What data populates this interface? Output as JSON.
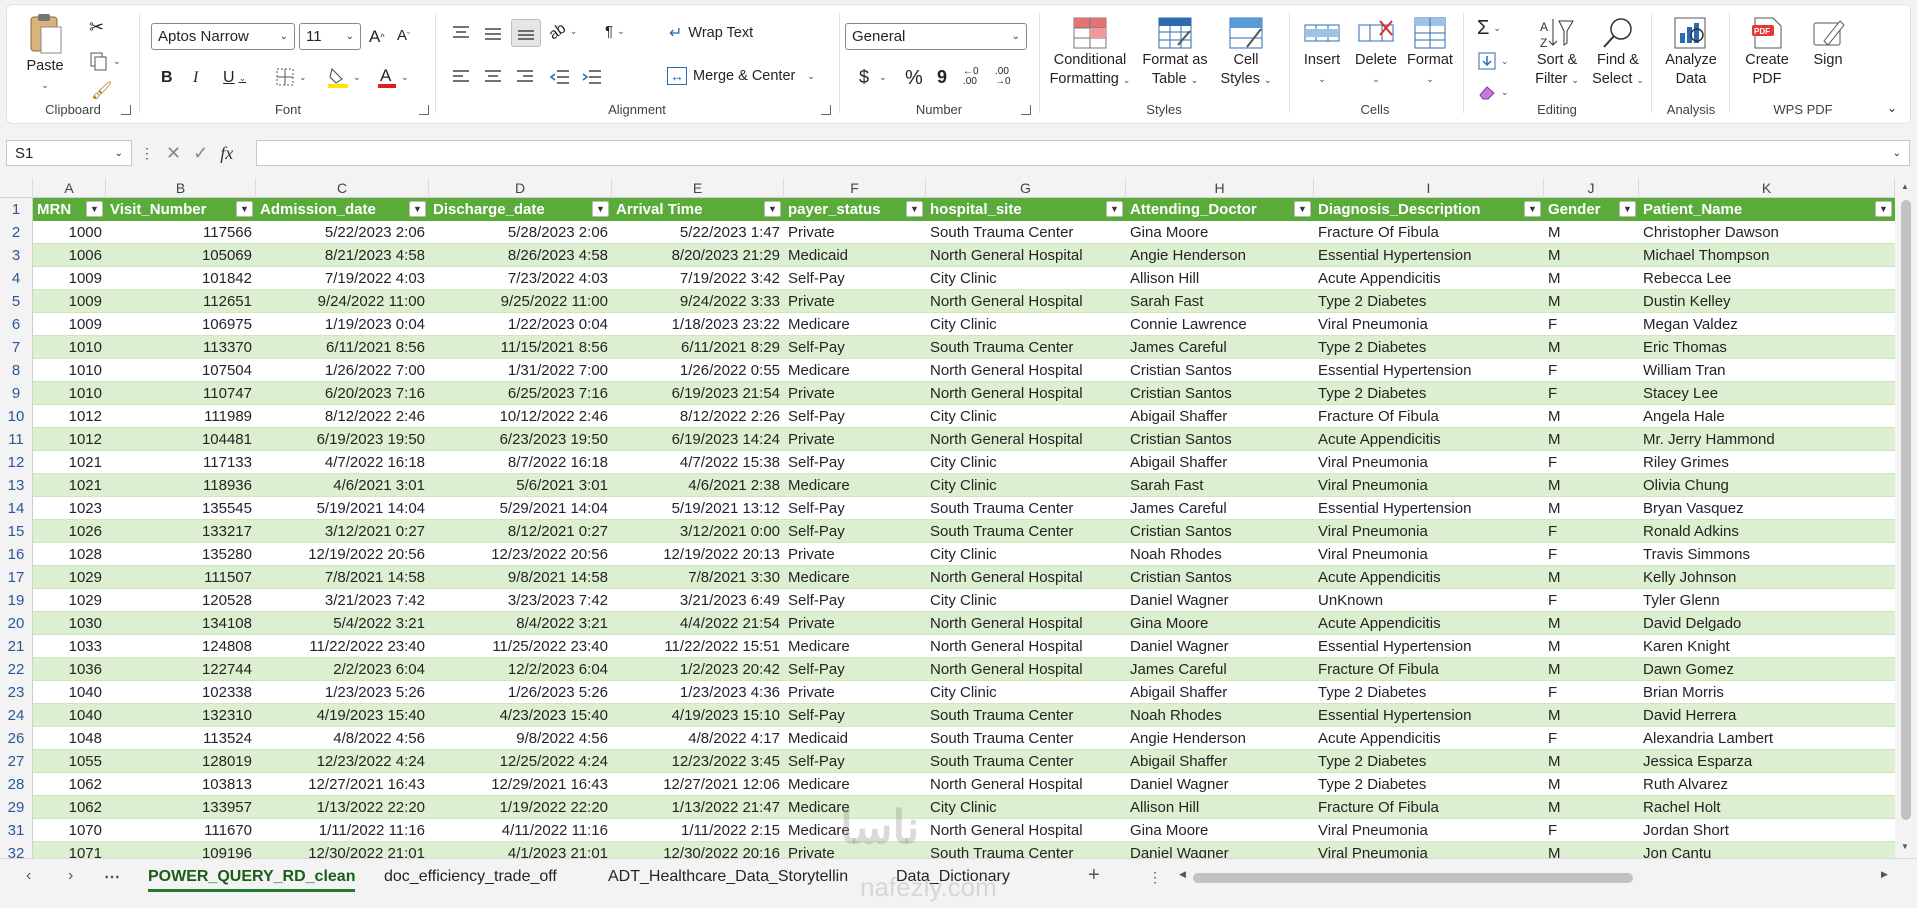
{
  "ribbon": {
    "clipboard": {
      "paste": "Paste",
      "label": "Clipboard"
    },
    "font": {
      "name": "Aptos Narrow",
      "size": "11",
      "label": "Font",
      "bold": "B",
      "italic": "I",
      "underline": "U",
      "font_color": "A"
    },
    "alignment": {
      "wrap": "Wrap Text",
      "merge": "Merge & Center",
      "label": "Alignment"
    },
    "number": {
      "format": "General",
      "currency": "$",
      "percent": "%",
      "comma": "9",
      "label": "Number"
    },
    "styles": {
      "conditional_1": "Conditional",
      "conditional_2": "Formatting",
      "format_table_1": "Format as",
      "format_table_2": "Table",
      "cell_styles_1": "Cell",
      "cell_styles_2": "Styles",
      "label": "Styles"
    },
    "cells": {
      "insert": "Insert",
      "delete": "Delete",
      "format": "Format",
      "label": "Cells"
    },
    "editing": {
      "sort_1": "Sort &",
      "sort_2": "Filter",
      "find_1": "Find &",
      "find_2": "Select",
      "label": "Editing"
    },
    "analysis": {
      "analyze_1": "Analyze",
      "analyze_2": "Data",
      "label": "Analysis"
    },
    "wps": {
      "create_1": "Create",
      "create_2": "PDF",
      "sign": "Sign",
      "label": "WPS PDF"
    }
  },
  "formula_bar": {
    "name_box": "S1",
    "fx": "fx",
    "formula": ""
  },
  "columns": [
    "A",
    "B",
    "C",
    "D",
    "E",
    "F",
    "G",
    "H",
    "I",
    "J",
    "K"
  ],
  "header": [
    "MRN",
    "Visit_Number",
    "Admission_date",
    "Discharge_date",
    "Arrival Time",
    "payer_status",
    "hospital_site",
    "Attending_Doctor",
    "Diagnosis_Description",
    "Gender",
    "Patient_Name"
  ],
  "rows": [
    {
      "n": "2",
      "cells": [
        "1000",
        "117566",
        "5/22/2023 2:06",
        "5/28/2023 2:06",
        "5/22/2023 1:47",
        "Private",
        "South Trauma Center",
        "Gina Moore",
        "Fracture Of Fibula",
        "M",
        "Christopher Dawson"
      ]
    },
    {
      "n": "3",
      "cells": [
        "1006",
        "105069",
        "8/21/2023 4:58",
        "8/26/2023 4:58",
        "8/20/2023 21:29",
        "Medicaid",
        "North General Hospital",
        "Angie Henderson",
        "Essential Hypertension",
        "M",
        "Michael Thompson"
      ]
    },
    {
      "n": "4",
      "cells": [
        "1009",
        "101842",
        "7/19/2022 4:03",
        "7/23/2022 4:03",
        "7/19/2022 3:42",
        "Self-Pay",
        "City Clinic",
        "Allison Hill",
        "Acute Appendicitis",
        "M",
        "Rebecca Lee"
      ]
    },
    {
      "n": "5",
      "cells": [
        "1009",
        "112651",
        "9/24/2022 11:00",
        "9/25/2022 11:00",
        "9/24/2022 3:33",
        "Private",
        "North General Hospital",
        "Sarah Fast",
        "Type 2 Diabetes",
        "M",
        "Dustin Kelley"
      ]
    },
    {
      "n": "6",
      "cells": [
        "1009",
        "106975",
        "1/19/2023 0:04",
        "1/22/2023 0:04",
        "1/18/2023 23:22",
        "Medicare",
        "City Clinic",
        "Connie Lawrence",
        "Viral Pneumonia",
        "F",
        "Megan Valdez"
      ]
    },
    {
      "n": "7",
      "cells": [
        "1010",
        "113370",
        "6/11/2021 8:56",
        "11/15/2021 8:56",
        "6/11/2021 8:29",
        "Self-Pay",
        "South Trauma Center",
        "James Careful",
        "Type 2 Diabetes",
        "M",
        "Eric Thomas"
      ]
    },
    {
      "n": "8",
      "cells": [
        "1010",
        "107504",
        "1/26/2022 7:00",
        "1/31/2022 7:00",
        "1/26/2022 0:55",
        "Medicare",
        "North General Hospital",
        "Cristian Santos",
        "Essential Hypertension",
        "F",
        "William Tran"
      ]
    },
    {
      "n": "9",
      "cells": [
        "1010",
        "110747",
        "6/20/2023 7:16",
        "6/25/2023 7:16",
        "6/19/2023 21:54",
        "Private",
        "North General Hospital",
        "Cristian Santos",
        "Type 2 Diabetes",
        "F",
        "Stacey Lee"
      ]
    },
    {
      "n": "10",
      "cells": [
        "1012",
        "111989",
        "8/12/2022 2:46",
        "10/12/2022 2:46",
        "8/12/2022 2:26",
        "Self-Pay",
        "City Clinic",
        "Abigail Shaffer",
        "Fracture Of Fibula",
        "M",
        "Angela Hale"
      ]
    },
    {
      "n": "11",
      "cells": [
        "1012",
        "104481",
        "6/19/2023 19:50",
        "6/23/2023 19:50",
        "6/19/2023 14:24",
        "Private",
        "North General Hospital",
        "Cristian Santos",
        "Acute Appendicitis",
        "M",
        "Mr. Jerry Hammond"
      ]
    },
    {
      "n": "12",
      "cells": [
        "1021",
        "117133",
        "4/7/2022 16:18",
        "8/7/2022 16:18",
        "4/7/2022 15:38",
        "Self-Pay",
        "City Clinic",
        "Abigail Shaffer",
        "Viral Pneumonia",
        "F",
        "Riley Grimes"
      ]
    },
    {
      "n": "13",
      "cells": [
        "1021",
        "118936",
        "4/6/2021 3:01",
        "5/6/2021 3:01",
        "4/6/2021 2:38",
        "Medicare",
        "City Clinic",
        "Sarah Fast",
        "Viral Pneumonia",
        "M",
        "Olivia Chung"
      ]
    },
    {
      "n": "14",
      "cells": [
        "1023",
        "135545",
        "5/19/2021 14:04",
        "5/29/2021 14:04",
        "5/19/2021 13:12",
        "Self-Pay",
        "South Trauma Center",
        "James Careful",
        "Essential Hypertension",
        "M",
        "Bryan Vasquez"
      ]
    },
    {
      "n": "15",
      "cells": [
        "1026",
        "133217",
        "3/12/2021 0:27",
        "8/12/2021 0:27",
        "3/12/2021 0:00",
        "Self-Pay",
        "South Trauma Center",
        "Cristian Santos",
        "Viral Pneumonia",
        "F",
        "Ronald Adkins"
      ]
    },
    {
      "n": "16",
      "cells": [
        "1028",
        "135280",
        "12/19/2022 20:56",
        "12/23/2022 20:56",
        "12/19/2022 20:13",
        "Private",
        "City Clinic",
        "Noah Rhodes",
        "Viral Pneumonia",
        "F",
        "Travis Simmons"
      ]
    },
    {
      "n": "17",
      "cells": [
        "1029",
        "111507",
        "7/8/2021 14:58",
        "9/8/2021 14:58",
        "7/8/2021 3:30",
        "Medicare",
        "North General Hospital",
        "Cristian Santos",
        "Acute Appendicitis",
        "M",
        "Kelly Johnson"
      ]
    },
    {
      "n": "19",
      "cells": [
        "1029",
        "120528",
        "3/21/2023 7:42",
        "3/23/2023 7:42",
        "3/21/2023 6:49",
        "Self-Pay",
        "City Clinic",
        "Daniel Wagner",
        "UnKnown",
        "F",
        "Tyler Glenn"
      ]
    },
    {
      "n": "20",
      "cells": [
        "1030",
        "134108",
        "5/4/2022 3:21",
        "8/4/2022 3:21",
        "4/4/2022 21:54",
        "Private",
        "North General Hospital",
        "Gina Moore",
        "Acute Appendicitis",
        "M",
        "David Delgado"
      ]
    },
    {
      "n": "21",
      "cells": [
        "1033",
        "124808",
        "11/22/2022 23:40",
        "11/25/2022 23:40",
        "11/22/2022 15:51",
        "Medicare",
        "North General Hospital",
        "Daniel Wagner",
        "Essential Hypertension",
        "M",
        "Karen Knight"
      ]
    },
    {
      "n": "22",
      "cells": [
        "1036",
        "122744",
        "2/2/2023 6:04",
        "12/2/2023 6:04",
        "1/2/2023 20:42",
        "Self-Pay",
        "North General Hospital",
        "James Careful",
        "Fracture Of Fibula",
        "M",
        "Dawn Gomez"
      ]
    },
    {
      "n": "23",
      "cells": [
        "1040",
        "102338",
        "1/23/2023 5:26",
        "1/26/2023 5:26",
        "1/23/2023 4:36",
        "Private",
        "City Clinic",
        "Abigail Shaffer",
        "Type 2 Diabetes",
        "F",
        "Brian Morris"
      ]
    },
    {
      "n": "24",
      "cells": [
        "1040",
        "132310",
        "4/19/2023 15:40",
        "4/23/2023 15:40",
        "4/19/2023 15:10",
        "Self-Pay",
        "South Trauma Center",
        "Noah Rhodes",
        "Essential Hypertension",
        "M",
        "David Herrera"
      ]
    },
    {
      "n": "26",
      "cells": [
        "1048",
        "113524",
        "4/8/2022 4:56",
        "9/8/2022 4:56",
        "4/8/2022 4:17",
        "Medicaid",
        "South Trauma Center",
        "Angie Henderson",
        "Acute Appendicitis",
        "F",
        "Alexandria Lambert"
      ]
    },
    {
      "n": "27",
      "cells": [
        "1055",
        "128019",
        "12/23/2022 4:24",
        "12/25/2022 4:24",
        "12/23/2022 3:45",
        "Self-Pay",
        "South Trauma Center",
        "Abigail Shaffer",
        "Type 2 Diabetes",
        "M",
        "Jessica Esparza"
      ]
    },
    {
      "n": "28",
      "cells": [
        "1062",
        "103813",
        "12/27/2021 16:43",
        "12/29/2021 16:43",
        "12/27/2021 12:06",
        "Medicare",
        "North General Hospital",
        "Daniel Wagner",
        "Type 2 Diabetes",
        "M",
        "Ruth Alvarez"
      ]
    },
    {
      "n": "29",
      "cells": [
        "1062",
        "133957",
        "1/13/2022 22:20",
        "1/19/2022 22:20",
        "1/13/2022 21:47",
        "Medicare",
        "City Clinic",
        "Allison Hill",
        "Fracture Of Fibula",
        "M",
        "Rachel Holt"
      ]
    },
    {
      "n": "31",
      "cells": [
        "1070",
        "111670",
        "1/11/2022 11:16",
        "4/11/2022 11:16",
        "1/11/2022 2:15",
        "Medicare",
        "North General Hospital",
        "Gina Moore",
        "Viral Pneumonia",
        "F",
        "Jordan Short"
      ]
    },
    {
      "n": "32",
      "cells": [
        "1071",
        "109196",
        "12/30/2022 21:01",
        "4/1/2023 21:01",
        "12/30/2022 20:16",
        "Private",
        "South Trauma Center",
        "Daniel Wagner",
        "Viral Pneumonia",
        "M",
        "Jon Cantu"
      ]
    }
  ],
  "sheets": {
    "tabs": [
      "POWER_QUERY_RD_clean",
      "doc_efficiency_trade_off",
      "ADT_Healthcare_Data_Storytellin",
      "Data_Dictionary"
    ],
    "active": 0,
    "add": "+",
    "more": "⋯"
  },
  "watermark": {
    "text": "ناسا",
    "url": "nafezly.com"
  }
}
